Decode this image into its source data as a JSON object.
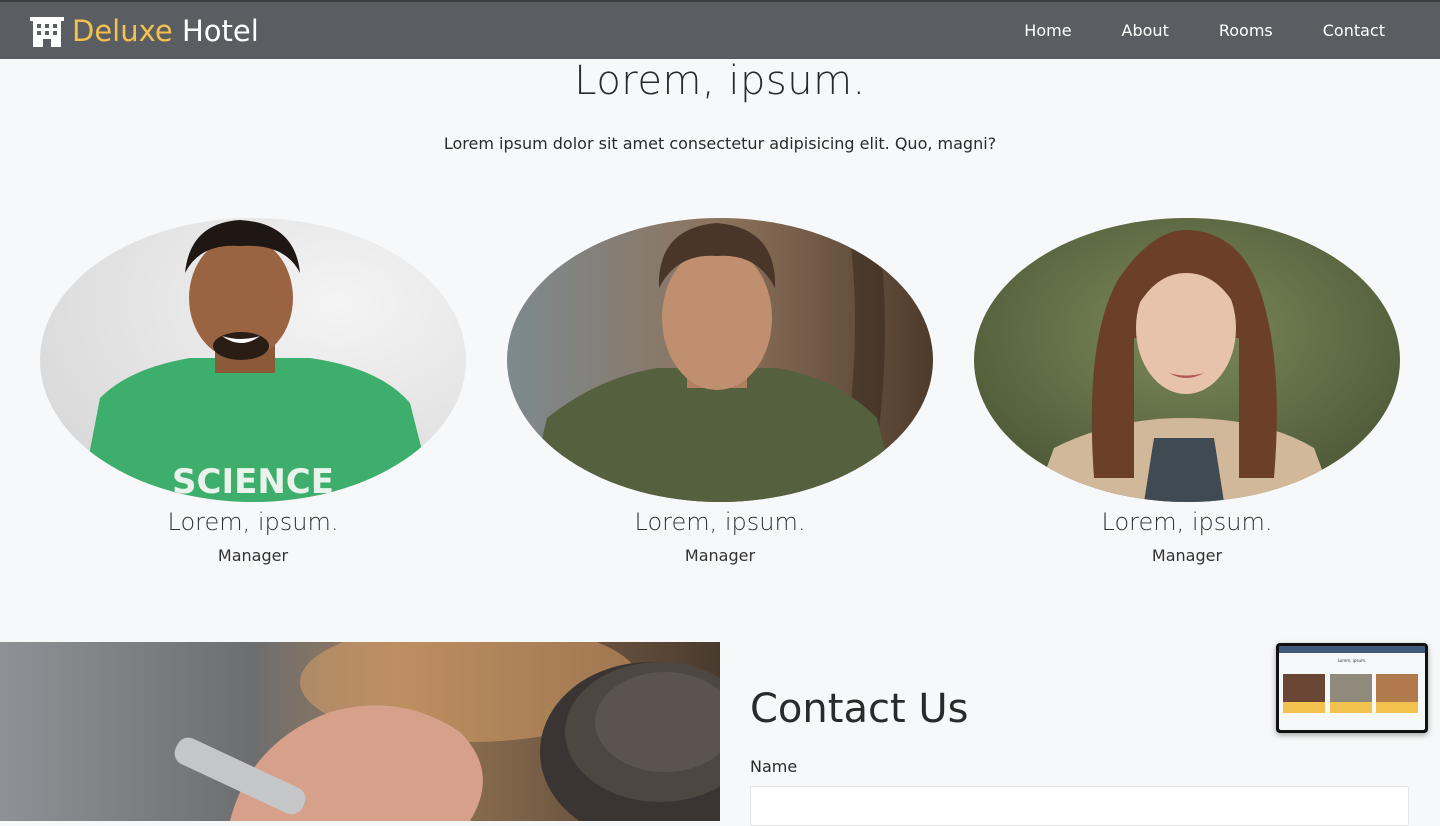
{
  "navbar": {
    "brand_accent": "Deluxe",
    "brand_rest": " Hotel",
    "links": [
      {
        "label": "Home"
      },
      {
        "label": "About"
      },
      {
        "label": "Rooms"
      },
      {
        "label": "Contact"
      }
    ]
  },
  "team": {
    "title": "Lorem, ipsum.",
    "subtitle": "Lorem ipsum dolor sit amet consectetur adipisicing elit. Quo, magni?",
    "members": [
      {
        "name": "Lorem, ipsum.",
        "role": "Manager",
        "shirt_text": "SCIENCE"
      },
      {
        "name": "Lorem, ipsum.",
        "role": "Manager"
      },
      {
        "name": "Lorem, ipsum.",
        "role": "Manager"
      }
    ]
  },
  "contact": {
    "title": "Contact Us",
    "name_label": "Name",
    "name_value": ""
  },
  "thumbnail": {
    "heading": "Lorem, ipsum."
  },
  "colors": {
    "navbar": "#5a5e63",
    "brand_accent": "#f2c14e",
    "page_bg": "#f7f8f9",
    "thumb_card": "#f2c14e"
  }
}
